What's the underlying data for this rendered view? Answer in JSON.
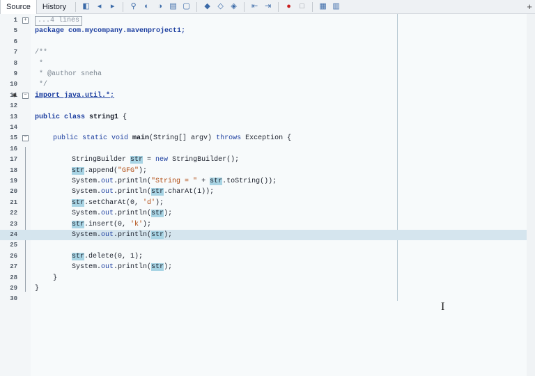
{
  "toolbar": {
    "tabs": [
      "Source",
      "History"
    ],
    "buttons": [
      "last-edit-icon",
      "back-icon",
      "forward-icon",
      "find-icon",
      "find-prev-icon",
      "find-next-icon",
      "toggle-highlight-icon",
      "toggle-rect-select-icon",
      "prev-bookmark-icon",
      "next-bookmark-icon",
      "toggle-bookmark-icon",
      "shift-left-icon",
      "shift-right-icon",
      "record-macro-icon",
      "stop-macro-icon",
      "comment-icon",
      "uncomment-icon"
    ],
    "plus": "+"
  },
  "editor": {
    "collapsed_label": "...4 lines",
    "lines": [
      {
        "n": "1"
      },
      {
        "n": "5"
      },
      {
        "n": "6"
      },
      {
        "n": "7"
      },
      {
        "n": "8"
      },
      {
        "n": "9"
      },
      {
        "n": "10"
      },
      {
        "n": "11"
      },
      {
        "n": "12"
      },
      {
        "n": "13"
      },
      {
        "n": "14"
      },
      {
        "n": "15"
      },
      {
        "n": "16"
      },
      {
        "n": "17"
      },
      {
        "n": "18"
      },
      {
        "n": "19"
      },
      {
        "n": "20"
      },
      {
        "n": "21"
      },
      {
        "n": "22"
      },
      {
        "n": "23"
      },
      {
        "n": "24"
      },
      {
        "n": "25"
      },
      {
        "n": "26"
      },
      {
        "n": "27"
      },
      {
        "n": "28"
      },
      {
        "n": "29"
      },
      {
        "n": "30"
      }
    ],
    "text": {
      "package": "package com.mycompany.mavenproject1;",
      "c_open": "/**",
      "c_star": " *",
      "c_author": " * @author sneha",
      "c_close": " */",
      "import": "import java.util.*;",
      "class_kw": "public class ",
      "class_name": "string1",
      "class_brace": " {",
      "main_kw1": "public static void ",
      "main_name": "main",
      "main_params": "(String[] argv) ",
      "main_throws": "throws",
      "main_exc": " Exception {",
      "l17a": "StringBuilder ",
      "l17b": "str",
      "l17c": " = ",
      "l17d": "new",
      "l17e": " StringBuilder();",
      "str": "str",
      "l18b": ".append(",
      "l18c": "\"GFG\"",
      "l18d": ");",
      "sys": "System.",
      "out": "out",
      "println": ".println(",
      "l19str": "\"String = \"",
      "l19b": " + ",
      "l19d": ".toString());",
      "l20d": ".charAt(1));",
      "l21b": ".setCharAt(0, ",
      "l21c": "'d'",
      "l21d": ");",
      "close_paren": ");",
      "l23b": ".insert(0, ",
      "l23c": "'k'",
      "l23d": ");",
      "l26b": ".delete(0, 1);",
      "brace_close_inner": "}",
      "brace_close_outer": "}"
    }
  },
  "colors": {
    "keyword": "#1d3fa0",
    "comment": "#7a8590",
    "string": "#b04a10",
    "highlight": "#a8d4e4",
    "current_line": "#d5e5ee"
  }
}
